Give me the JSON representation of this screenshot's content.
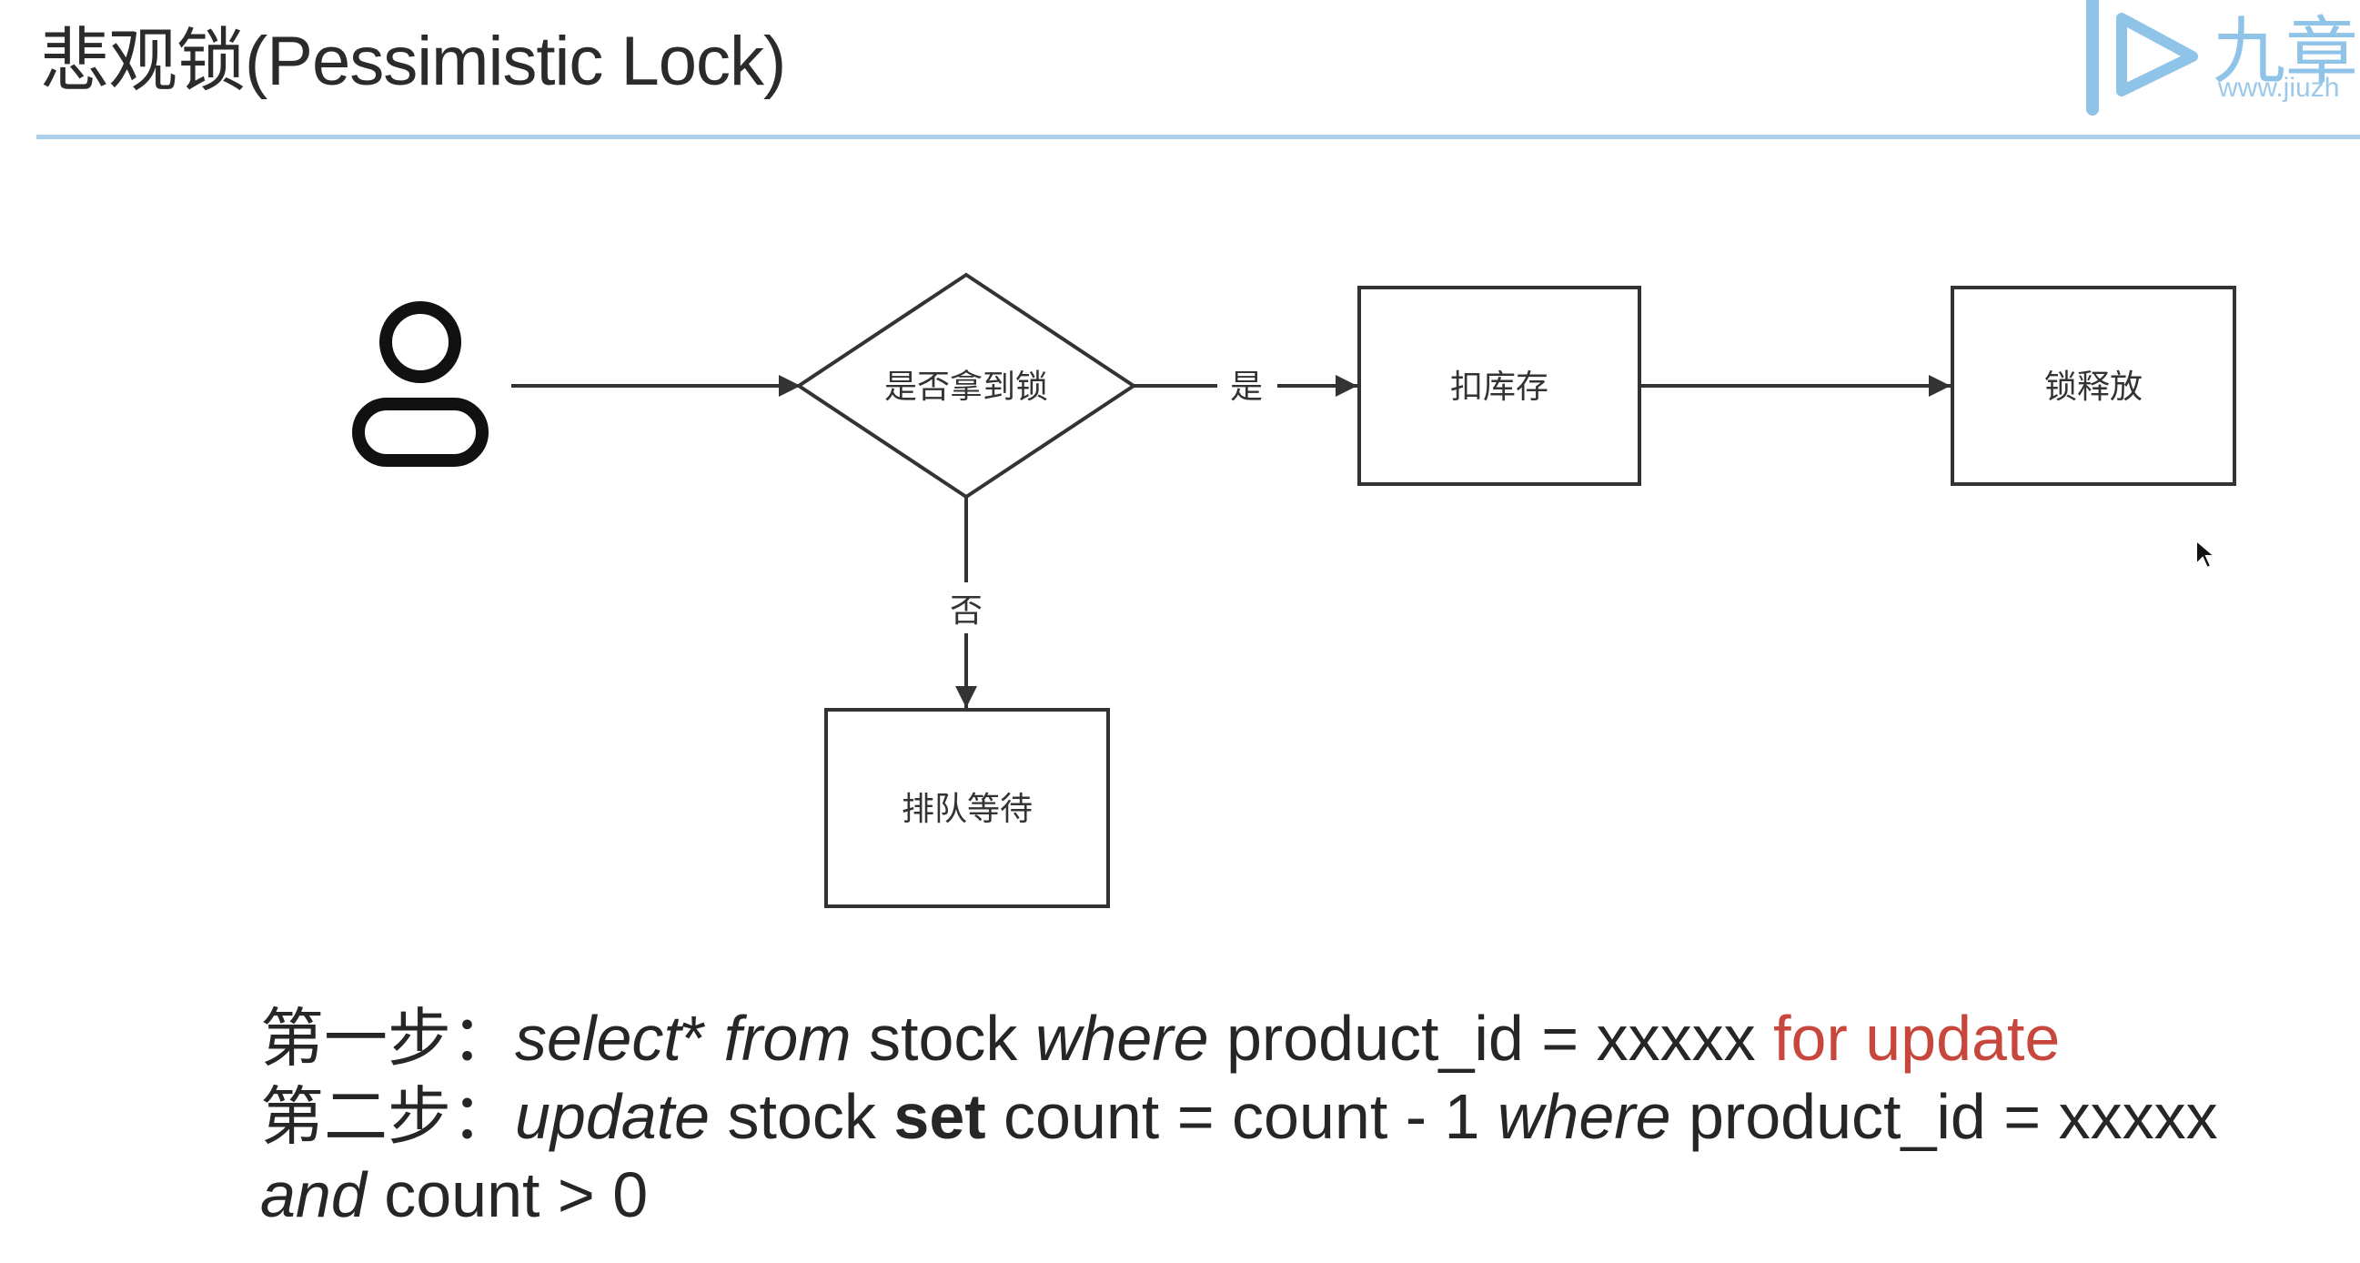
{
  "slide": {
    "title": "悲观锁(Pessimistic Lock)"
  },
  "brand": {
    "name": "九章",
    "url": "www.jiuzh"
  },
  "diagram": {
    "nodes": {
      "decision": "是否拿到锁",
      "deduct": "扣库存",
      "release": "锁释放",
      "queue": "排队等待"
    },
    "edges": {
      "yes": "是",
      "no": "否"
    }
  },
  "code": {
    "step1": {
      "prefix": "第一步：",
      "kw_select": "select",
      "star": "* ",
      "kw_from": "from",
      "t1": " stock ",
      "kw_where": "where",
      "t2": " product_id = xxxxx ",
      "highlight": "for update"
    },
    "step2": {
      "prefix": "第二步：",
      "kw_update": "update",
      "t1": " stock ",
      "kw_set": "set",
      "t2": " count = count - 1 ",
      "kw_where": "where",
      "t3": " product_id = xxxxx"
    },
    "step2_cont": {
      "kw_and": "and",
      "t1": " count > 0"
    }
  },
  "colors": {
    "title_rule": "#a9cfea",
    "highlight": "#c8473c",
    "brand": "#8fc3e8"
  }
}
